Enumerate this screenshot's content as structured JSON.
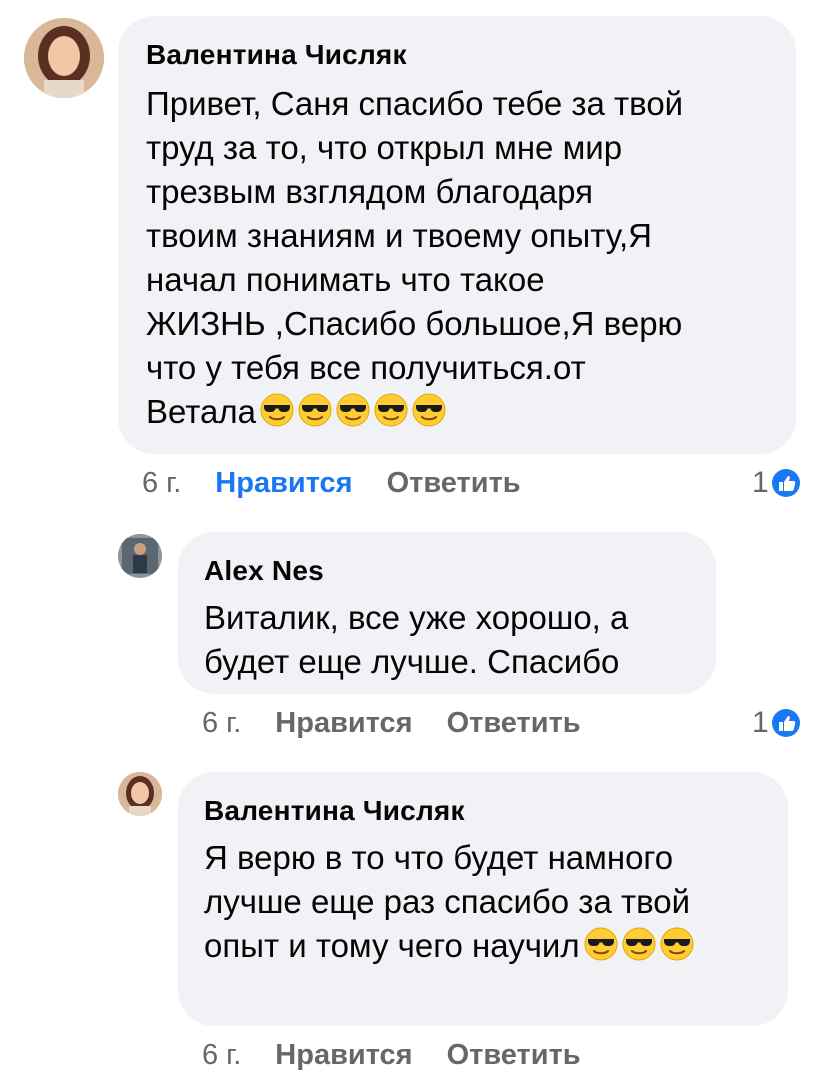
{
  "comments": [
    {
      "author": "Валентина Числяк",
      "text": "Привет, Саня  спасибо тебе за твой\nтруд за то, что открыл мне мир\nтрезвым взглядом благодаря\nтвоим знаниям и твоему опыту,Я\nначал понимать что такое\nЖИЗНЬ ,Спасибо большое,Я верю\nчто у тебя все получиться.от\nВетала",
      "emoji_count": 5,
      "time": "6 г.",
      "like_label": "Нравится",
      "reply_label": "Ответить",
      "reactions": "1"
    },
    {
      "author": "Alex Nes",
      "text": "Виталик, все уже хорошо, а\nбудет еще лучше. Спасибо",
      "time": "6 г.",
      "like_label": "Нравится",
      "reply_label": "Ответить",
      "reactions": "1"
    },
    {
      "author": "Валентина Числяк",
      "text": "Я верю в то что будет намного\nлучше еще раз спасибо за твой\nопыт и тому чего научил",
      "time": "6 г.",
      "like_label": "Нравится",
      "reply_label": "Ответить"
    }
  ],
  "colors": {
    "bubble": "#f0f2f5",
    "meta": "#65676b",
    "liked": "#1877f2"
  },
  "icons": [
    "sunglasses-emoji-icon",
    "like-thumb-icon"
  ]
}
